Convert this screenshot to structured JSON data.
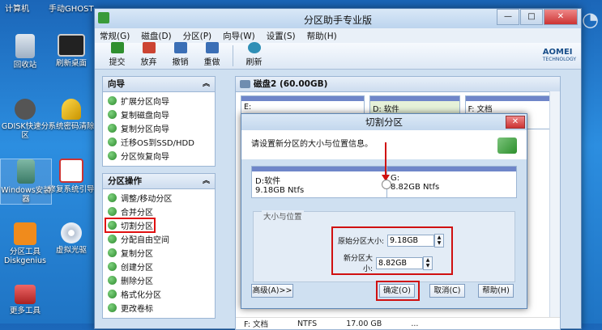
{
  "desktop": {
    "top_labels": [
      "计算机",
      "手动GHOST"
    ],
    "icons": [
      {
        "label": "回收站"
      },
      {
        "label": "刷新桌面"
      },
      {
        "label": "GDISK快速分区"
      },
      {
        "label": "系统密码清除"
      },
      {
        "label": "Windows安装器"
      },
      {
        "label": "修复系统引导"
      },
      {
        "label": "分区工具Diskgenius"
      },
      {
        "label": "虚拟光驱"
      },
      {
        "label": "更多工具"
      }
    ]
  },
  "window": {
    "title": "分区助手专业版",
    "controls": {
      "min": "—",
      "max": "□",
      "close": "✕"
    },
    "menu": [
      "常规(G)",
      "磁盘(D)",
      "分区(P)",
      "向导(W)",
      "设置(S)",
      "帮助(H)"
    ],
    "toolbar": [
      "提交",
      "放弃",
      "撤销",
      "重做",
      "刷新"
    ],
    "brand": {
      "name": "AOMEI",
      "sub": "TECHNOLOGY"
    }
  },
  "wizard_panel": {
    "title": "向导",
    "items": [
      "扩展分区向导",
      "复制磁盘向导",
      "复制分区向导",
      "迁移OS到SSD/HDD",
      "分区恢复向导"
    ]
  },
  "ops_panel": {
    "title": "分区操作",
    "items": [
      "调整/移动分区",
      "合并分区",
      "切割分区",
      "分配自由空间",
      "复制分区",
      "创建分区",
      "删除分区",
      "格式化分区",
      "更改卷标"
    ]
  },
  "disk": {
    "header": "磁盘2 (60.00GB)",
    "partitions": [
      {
        "label": "E:"
      },
      {
        "label": "D: 软件"
      },
      {
        "label": "F: 文档"
      }
    ],
    "bottom_row": [
      "F: 文档",
      "NTFS",
      "17.00 GB",
      "..."
    ]
  },
  "dialog": {
    "title": "切割分区",
    "info": "请设置新分区的大小与位置信息。",
    "left_part": {
      "name": "D:软件",
      "detail": "9.18GB Ntfs"
    },
    "right_part": {
      "name": "G:",
      "detail": "8.82GB Ntfs"
    },
    "group_label": "大小与位置",
    "orig_label": "原始分区大小:",
    "orig_value": "9.18GB",
    "new_label": "新分区大小:",
    "new_value": "8.82GB",
    "buttons": {
      "advanced": "高级(A)>>",
      "ok": "确定(O)",
      "cancel": "取消(C)",
      "help": "帮助(H)"
    }
  },
  "colors": {
    "accent": "#d01010",
    "partition_bar": "#6f86c9"
  }
}
